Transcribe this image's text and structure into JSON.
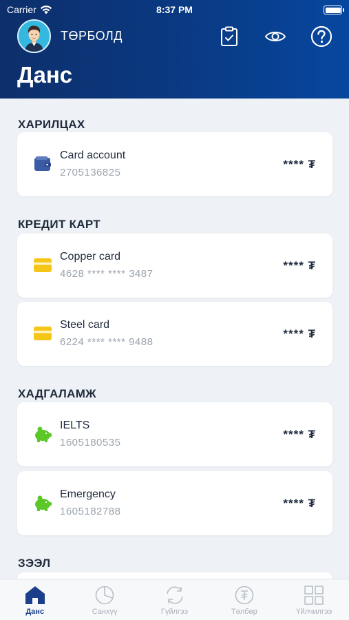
{
  "status_bar": {
    "carrier": "Carrier",
    "time": "8:37 PM"
  },
  "header": {
    "username": "ТӨРБОЛД",
    "title": "Данс"
  },
  "sections": [
    {
      "title": "ХАРИЛЦАХ",
      "accounts": [
        {
          "name": "Card account",
          "number": "2705136825",
          "balance": "**** ₮",
          "icon": "wallet-icon"
        }
      ]
    },
    {
      "title": "КРЕДИТ КАРТ",
      "accounts": [
        {
          "name": "Copper card",
          "number": "4628 **** **** 3487",
          "balance": "**** ₮",
          "icon": "credit-card-icon"
        },
        {
          "name": "Steel card",
          "number": "6224 **** **** 9488",
          "balance": "**** ₮",
          "icon": "credit-card-icon"
        }
      ]
    },
    {
      "title": "ХАДГАЛАМЖ",
      "accounts": [
        {
          "name": "IELTS",
          "number": "1605180535",
          "balance": "**** ₮",
          "icon": "piggy-bank-icon"
        },
        {
          "name": "Emergency",
          "number": "1605182788",
          "balance": "**** ₮",
          "icon": "piggy-bank-icon"
        }
      ]
    },
    {
      "title": "ЗЭЭЛ",
      "accounts": []
    }
  ],
  "tabs": [
    {
      "label": "Данс",
      "icon": "home-icon",
      "active": true
    },
    {
      "label": "Санхүү",
      "icon": "pie-chart-icon",
      "active": false
    },
    {
      "label": "Гүйлгээ",
      "icon": "refresh-icon",
      "active": false
    },
    {
      "label": "Төлбөр",
      "icon": "tugrik-coin-icon",
      "active": false
    },
    {
      "label": "Үйлчилгээ",
      "icon": "grid-icon",
      "active": false
    }
  ],
  "colors": {
    "header_bg": "#0a3a84",
    "wallet": "#3b5ba5",
    "card": "#f5c518",
    "piggy": "#5cc828",
    "active_tab": "#1b3f8a"
  }
}
